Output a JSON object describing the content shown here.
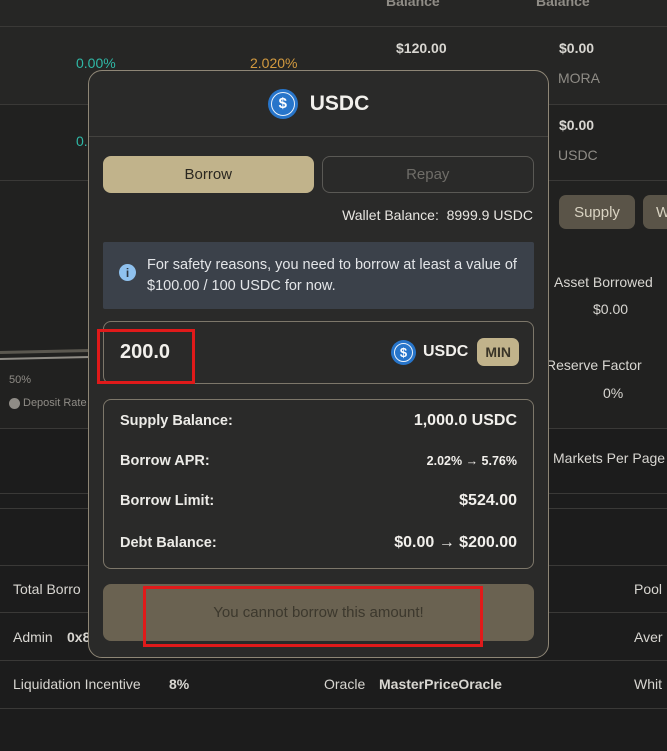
{
  "background": {
    "header_cols": [
      "Balance",
      "Balance"
    ],
    "row1": {
      "supply_apy": "0.00%",
      "borrow_apy": "2.020%",
      "supply_balance": "$120.00",
      "borrow_balance": "$0.00",
      "borrow_sub": "MORA"
    },
    "row2": {
      "supply_apy": "0.",
      "borrow_balance": "$0.00",
      "borrow_sub": "USDC"
    },
    "buttons": {
      "supply": "Supply",
      "withdraw_partial": "W"
    },
    "asset_borrowed": {
      "label": "Asset Borrowed",
      "value": "$0.00"
    },
    "reserve_factor": {
      "label": "Reserve Factor",
      "value": "0%"
    },
    "chart": {
      "percent_label": "50%",
      "legend": "Deposit Rate"
    },
    "markets_per_page": "Markets Per Page",
    "info_rows": [
      {
        "label": "Total Borro",
        "right": "Pool"
      },
      {
        "label": "Admin",
        "value": "0x8",
        "right": "Aver"
      },
      {
        "label": "Liquidation Incentive",
        "value": "8%",
        "oracle_label": "Oracle",
        "oracle_value": "MasterPriceOracle",
        "right": "Whit"
      }
    ]
  },
  "modal": {
    "title": "USDC",
    "tabs": {
      "borrow": "Borrow",
      "repay": "Repay"
    },
    "wallet_label": "Wallet Balance:",
    "wallet_value": "8999.9 USDC",
    "info_text": "For safety reasons, you need to borrow at least a value of $100.00 / 100 USDC for now.",
    "amount_value": "200.0",
    "amount_unit": "USDC",
    "min_label": "MIN",
    "stats": [
      {
        "label": "Supply Balance:",
        "value": "1,000.0 USDC"
      },
      {
        "label": "Borrow APR:",
        "value": "2.02% → 5.76%"
      },
      {
        "label": "Borrow Limit:",
        "value": "$524.00"
      },
      {
        "label": "Debt Balance:",
        "value": "$0.00 → $200.00"
      }
    ],
    "submit_label": "You cannot borrow this amount!"
  },
  "colors": {
    "accent": "#c1b38b",
    "highlight": "#e01a1a",
    "usdc": "#2775ca"
  }
}
